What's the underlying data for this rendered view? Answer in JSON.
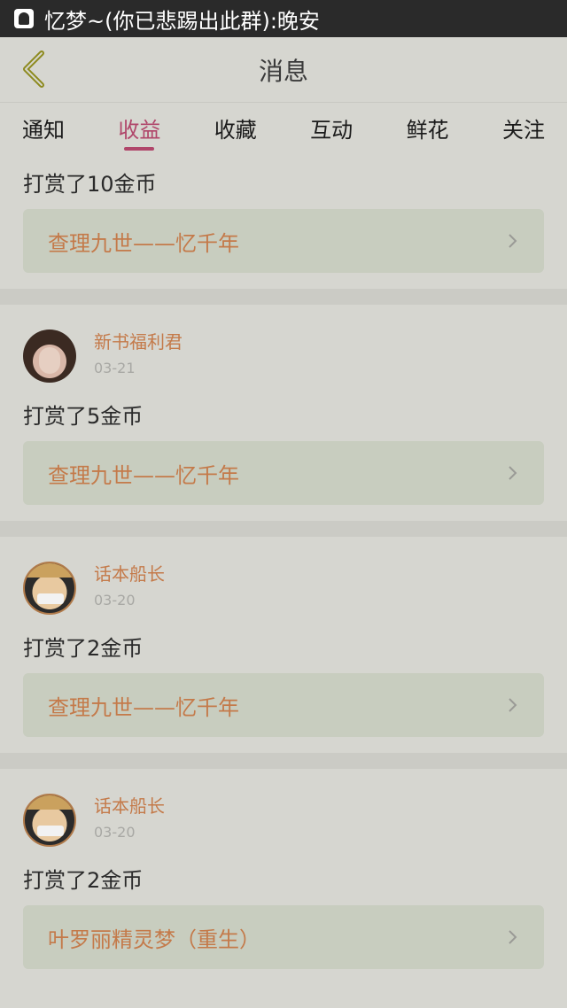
{
  "status_bar": {
    "notification_text": "忆梦~(你已悲踢出此群):晚安"
  },
  "header": {
    "title": "消息"
  },
  "tabs": [
    {
      "label": "通知",
      "active": false
    },
    {
      "label": "收益",
      "active": true
    },
    {
      "label": "收藏",
      "active": false
    },
    {
      "label": "互动",
      "active": false
    },
    {
      "label": "鲜花",
      "active": false
    },
    {
      "label": "关注",
      "active": false
    }
  ],
  "feed": [
    {
      "tip": "打赏了10金币",
      "book": "查理九世——忆千年"
    },
    {
      "username": "新书福利君",
      "date": "03-21",
      "tip": "打赏了5金币",
      "book": "查理九世——忆千年"
    },
    {
      "username": "话本船长",
      "date": "03-20",
      "tip": "打赏了2金币",
      "book": "查理九世——忆千年"
    },
    {
      "username": "话本船长",
      "date": "03-20",
      "tip": "打赏了2金币",
      "book": "叶罗丽精灵梦（重生）"
    }
  ],
  "colors": {
    "accent": "#b0466a",
    "link_text": "#c47a4a",
    "background": "#d6d6d0"
  }
}
